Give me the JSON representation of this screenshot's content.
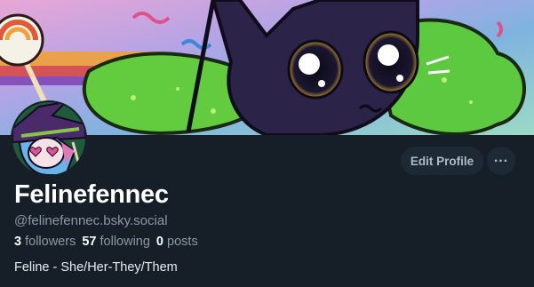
{
  "profile": {
    "display_name": "Felinefennec",
    "handle": "@felinefennec.bsky.social",
    "bio": "Feline - She/Her-They/Them"
  },
  "stats": {
    "followers_count": "3",
    "followers_label": "followers",
    "following_count": "57",
    "following_label": "following",
    "posts_count": "0",
    "posts_label": "posts"
  },
  "actions": {
    "edit_profile_label": "Edit Profile",
    "more_label": "..."
  },
  "icons": {
    "more": "ellipsis-icon"
  },
  "colors": {
    "background": "#161e27",
    "button_bg": "#1e2936",
    "primary_text": "#ffffff",
    "secondary_text": "#8b98a5"
  }
}
